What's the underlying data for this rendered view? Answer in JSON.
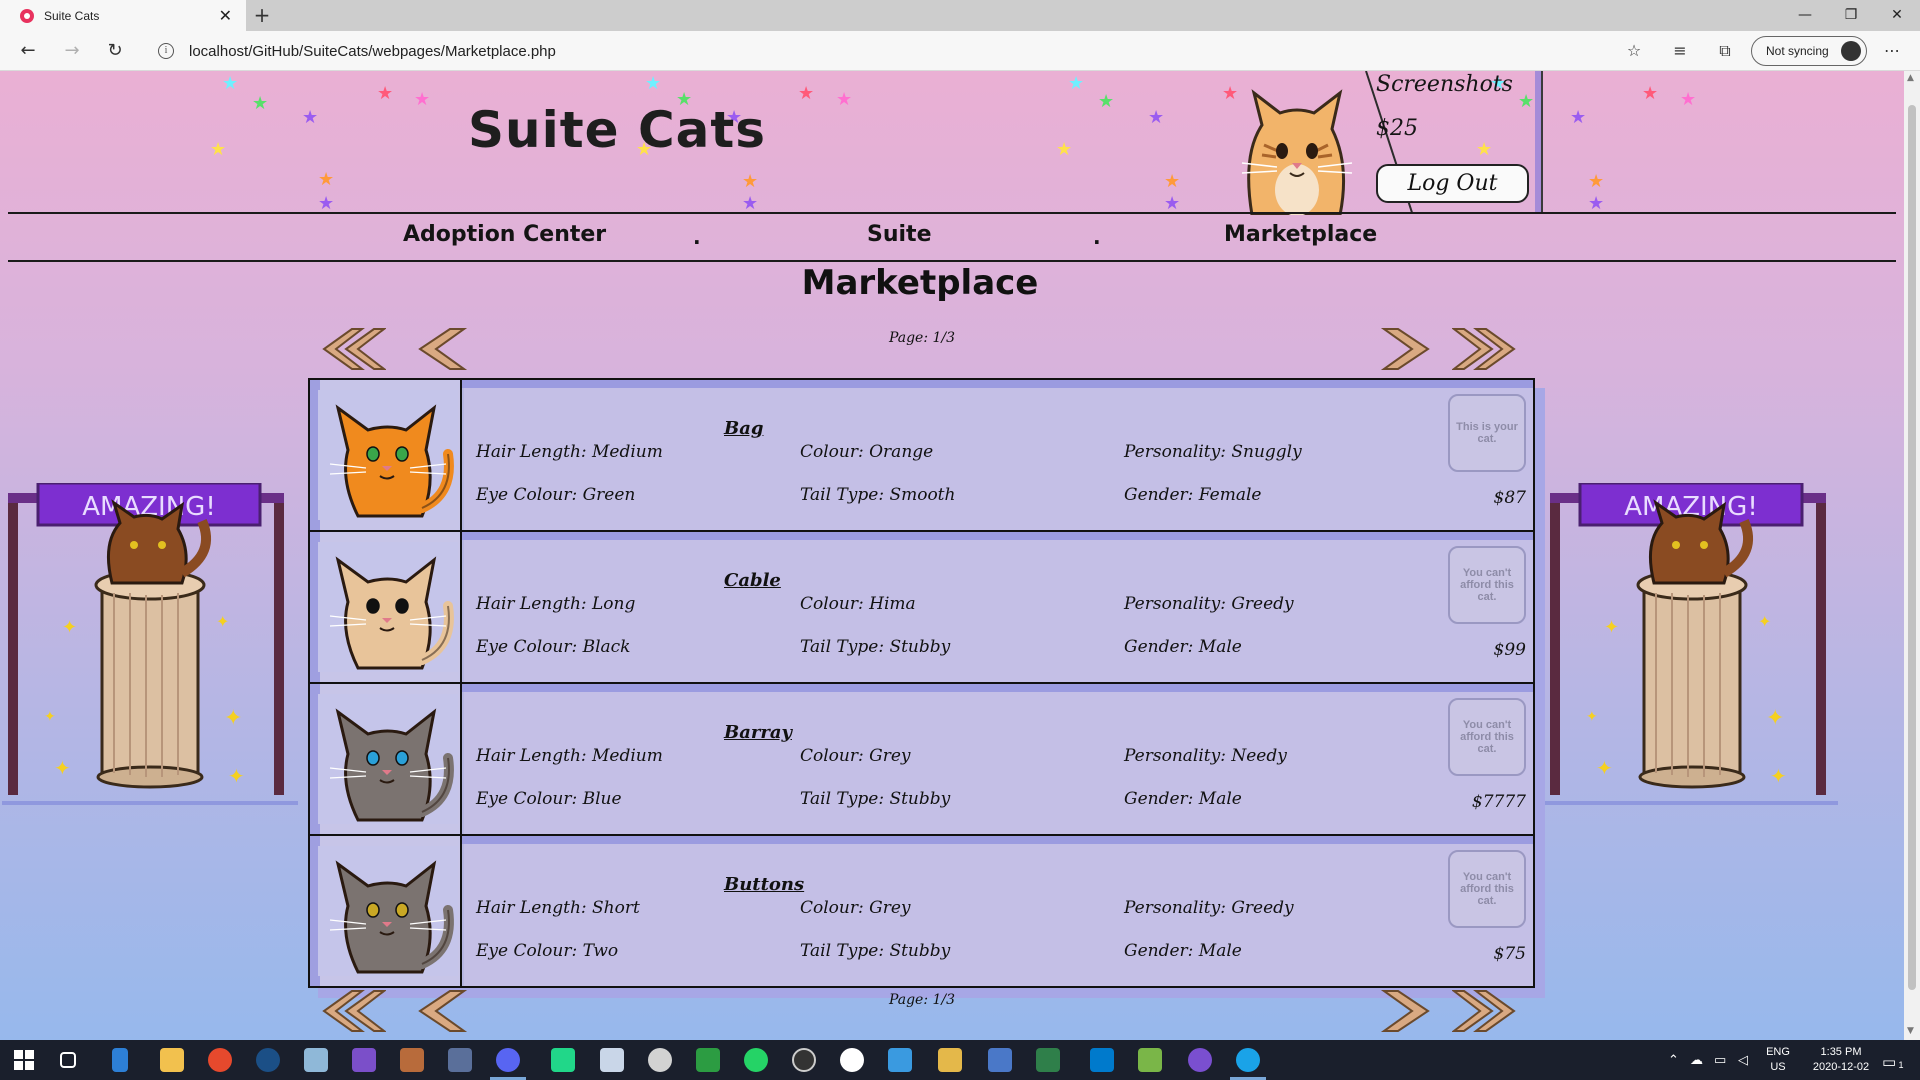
{
  "browser": {
    "tab_title": "Suite Cats",
    "tab_close": "✕",
    "new_tab": "+",
    "url": "localhost/GitHub/SuiteCats/webpages/Marketplace.php",
    "sync_label": "Not syncing",
    "win_min": "—",
    "win_max": "❐",
    "win_close": "✕"
  },
  "header": {
    "site_title": "Suite Cats",
    "screenshots_link": "Screenshots",
    "balance": "$25",
    "logout_label": "Log Out"
  },
  "nav": {
    "items": [
      "Adoption Center",
      "Suite",
      "Marketplace"
    ],
    "separator": "."
  },
  "page": {
    "heading": "Marketplace",
    "page_label_top": "Page: 1/3",
    "page_label_bottom": "Page: 1/3",
    "booth_sign": "AMAZING!"
  },
  "listings": [
    {
      "name": "Bag",
      "hair": "Hair Length: Medium",
      "colour": "Colour: Orange",
      "personality": "Personality: Snuggly",
      "eye": "Eye Colour: Green",
      "tail": "Tail Type: Smooth",
      "gender": "Gender: Female",
      "button": "This is your cat.",
      "price": "$87",
      "fur": "#f08a1e",
      "eye_color": "#3aa64a"
    },
    {
      "name": "Cable",
      "hair": "Hair Length: Long",
      "colour": "Colour: Hima",
      "personality": "Personality: Greedy",
      "eye": "Eye Colour: Black",
      "tail": "Tail Type: Stubby",
      "gender": "Gender: Male",
      "button": "You can't afford this cat.",
      "price": "$99",
      "fur": "#e8c49a",
      "eye_color": "#111111"
    },
    {
      "name": "Barray",
      "hair": "Hair Length: Medium",
      "colour": "Colour: Grey",
      "personality": "Personality: Needy",
      "eye": "Eye Colour: Blue",
      "tail": "Tail Type: Stubby",
      "gender": "Gender: Male",
      "button": "You can't afford this cat.",
      "price": "$7777",
      "fur": "#7b7370",
      "eye_color": "#2aa0d8"
    },
    {
      "name": "Buttons",
      "hair": "Hair Length: Short",
      "colour": "Colour: Grey",
      "personality": "Personality: Greedy",
      "eye": "Eye Colour: Two",
      "tail": "Tail Type: Stubby",
      "gender": "Gender: Male",
      "button": "You can't afford this cat.",
      "price": "$75",
      "fur": "#7b7370",
      "eye_color": "#c9a825"
    }
  ],
  "taskbar": {
    "lang": "ENG",
    "region": "US",
    "time": "1:35 PM",
    "date": "2020-12-02",
    "notifications": "1"
  },
  "colors": {
    "accent_purple": "#7d2fd0",
    "arrow_fill": "#d9a982",
    "arrow_stroke": "#6b4a2c"
  }
}
